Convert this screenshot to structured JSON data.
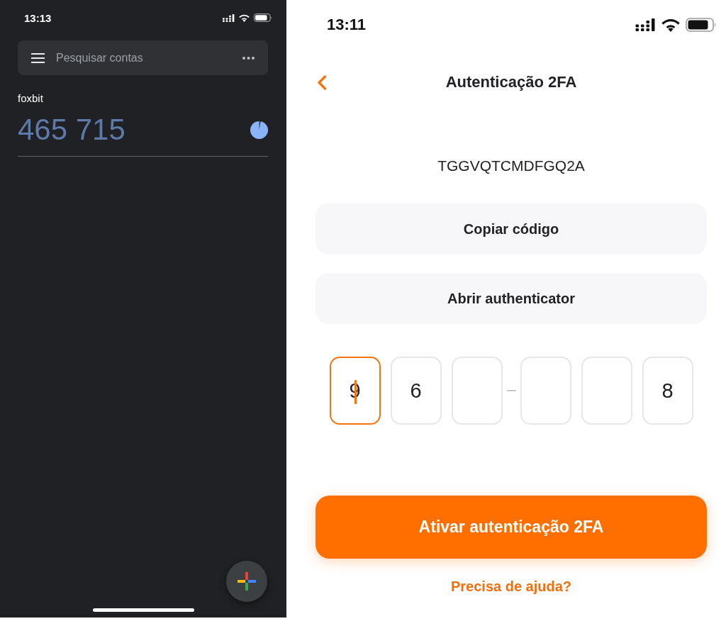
{
  "left_screen": {
    "status_bar": {
      "time": "13:13"
    },
    "search": {
      "placeholder": "Pesquisar contas"
    },
    "accounts": [
      {
        "name": "foxbit",
        "code": "465 715",
        "level": 0.97
      }
    ]
  },
  "right_screen": {
    "status_bar": {
      "time": "13:11"
    },
    "header": {
      "title": "Autenticação 2FA"
    },
    "secret_key": "TGGVQTCMDFGQ2A",
    "secondary_buttons": [
      "Copiar código",
      "Abrir authenticator"
    ],
    "code_groups": [
      [
        {
          "value": "9",
          "focused": true
        },
        {
          "value": "6",
          "focused": false
        },
        {
          "focused": false
        }
      ],
      [
        {
          "focused": false
        },
        {
          "focused": false
        },
        {
          "value": "8",
          "focused": false
        }
      ]
    ],
    "primary_button": {
      "label": "Ativar autenticação 2FA"
    },
    "help_link": "Precisa de ajuda?"
  }
}
